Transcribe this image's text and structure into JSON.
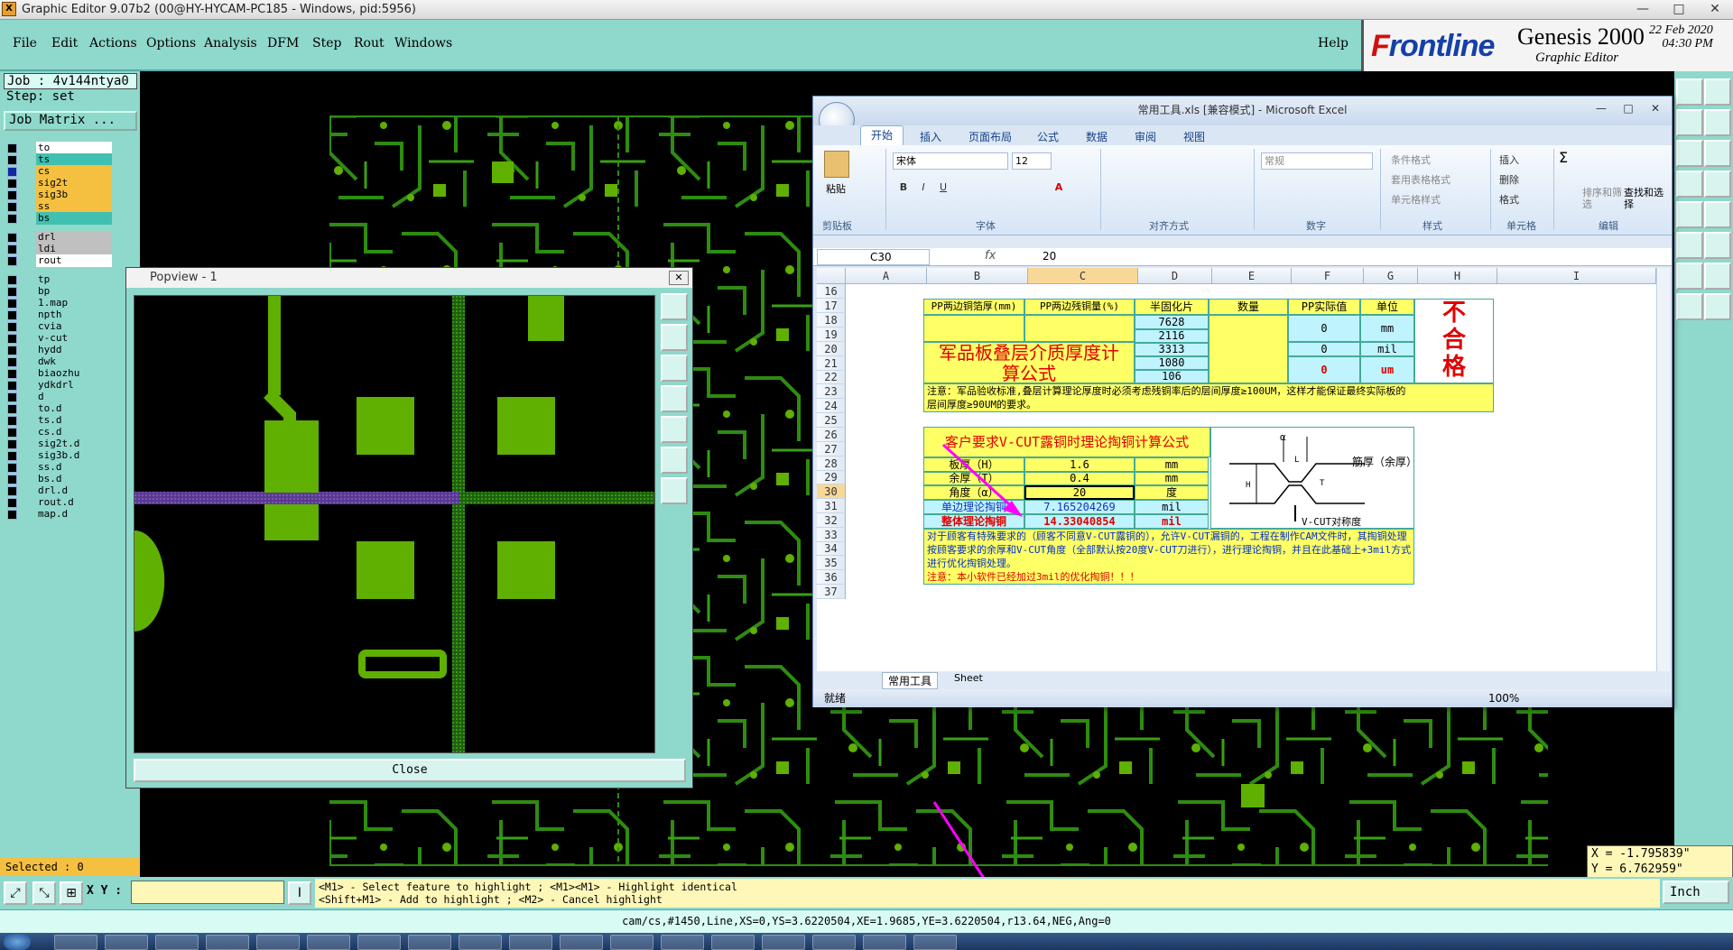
{
  "window": {
    "title": "Graphic Editor 9.07b2 (00@HY-HYCAM-PC185 - Windows, pid:5956)",
    "icon": "genesis-app-icon",
    "minimize": "—",
    "maximize": "□",
    "close": "✕"
  },
  "menu": {
    "items": [
      "File",
      "Edit",
      "Actions",
      "Options",
      "Analysis",
      "DFM",
      "Step",
      "Rout",
      "Windows"
    ],
    "help": "Help"
  },
  "logo": {
    "brand_f": "F",
    "brand": "rontline",
    "product": "Genesis 2000",
    "subtitle": "Graphic Editor",
    "date": "22 Feb 2020",
    "time": "04:30 PM"
  },
  "job": {
    "job_label": "Job : 4v144ntya0",
    "step_label": "Step: set",
    "matrix_button": "Job Matrix ..."
  },
  "layers": [
    {
      "name": "to",
      "color": "#ffffff",
      "checked": false
    },
    {
      "name": "ts",
      "color": "#40c0b0",
      "checked": false
    },
    {
      "name": "cs",
      "color": "#f5c040",
      "checked": true
    },
    {
      "name": "sig2t",
      "color": "#f5c040",
      "checked": false
    },
    {
      "name": "sig3b",
      "color": "#f5c040",
      "checked": false
    },
    {
      "name": "ss",
      "color": "#f5c040",
      "checked": false
    },
    {
      "name": "bs",
      "color": "#40c0b0",
      "checked": false
    },
    {
      "name": "drl",
      "color": "#c0c0c0",
      "checked": false
    },
    {
      "name": "ldi",
      "color": "#c0c0c0",
      "checked": false
    },
    {
      "name": "rout",
      "color": "#ffffff",
      "checked": false
    },
    {
      "name": "tp",
      "color": "#8fd8cc",
      "checked": false
    },
    {
      "name": "bp",
      "color": "#8fd8cc",
      "checked": false
    },
    {
      "name": "1.map",
      "color": "#8fd8cc",
      "checked": false
    },
    {
      "name": "npth",
      "color": "#8fd8cc",
      "checked": false
    },
    {
      "name": "cvia",
      "color": "#8fd8cc",
      "checked": false
    },
    {
      "name": "v-cut",
      "color": "#8fd8cc",
      "checked": false
    },
    {
      "name": "hydd",
      "color": "#8fd8cc",
      "checked": false
    },
    {
      "name": "dwk",
      "color": "#8fd8cc",
      "checked": false
    },
    {
      "name": "biaozhu",
      "color": "#8fd8cc",
      "checked": false
    },
    {
      "name": "ydkdrl",
      "color": "#8fd8cc",
      "checked": false
    },
    {
      "name": "d",
      "color": "#8fd8cc",
      "checked": false
    },
    {
      "name": "to.d",
      "color": "#8fd8cc",
      "checked": false
    },
    {
      "name": "ts.d",
      "color": "#8fd8cc",
      "checked": false
    },
    {
      "name": "cs.d",
      "color": "#8fd8cc",
      "checked": false
    },
    {
      "name": "sig2t.d",
      "color": "#8fd8cc",
      "checked": false
    },
    {
      "name": "sig3b.d",
      "color": "#8fd8cc",
      "checked": false
    },
    {
      "name": "ss.d",
      "color": "#8fd8cc",
      "checked": false
    },
    {
      "name": "bs.d",
      "color": "#8fd8cc",
      "checked": false
    },
    {
      "name": "drl.d",
      "color": "#8fd8cc",
      "checked": false
    },
    {
      "name": "rout.d",
      "color": "#8fd8cc",
      "checked": false
    },
    {
      "name": "map.d",
      "color": "#8fd8cc",
      "checked": false
    }
  ],
  "selected": "Selected : 0",
  "coords": {
    "x": "X = -1.795839\"",
    "y": "Y = 6.762959\""
  },
  "bottom": {
    "xy_label": "X Y :",
    "xy_value": "",
    "hint_line1": "<M1> - Select feature to highlight ; <M1><M1> - Highlight identical",
    "hint_line2": "<Shift+M1> - Add to highlight ; <M2> - Cancel highlight",
    "units": "Inch"
  },
  "status": "cam/cs,#1450,Line,XS=0,YS=3.6220504,XE=1.9685,YE=3.6220504,r13.64,NEG,Ang=0",
  "popview": {
    "title": "Popview - 1",
    "close": "Close"
  },
  "excel": {
    "title": "常用工具.xls  [兼容模式] - Microsoft Excel",
    "tabs": [
      "开始",
      "插入",
      "页面布局",
      "公式",
      "数据",
      "审阅",
      "视图"
    ],
    "groups": [
      "剪贴板",
      "字体",
      "对齐方式",
      "数字",
      "样式",
      "单元格",
      "编辑"
    ],
    "paste": "粘贴",
    "font": "宋体",
    "size": "12",
    "numfmt": "常规",
    "styles": [
      "条件格式",
      "套用表格格式",
      "单元格样式"
    ],
    "cells_btns": [
      "插入",
      "删除",
      "格式"
    ],
    "edit_btns": [
      "排序和筛选",
      "查找和选择"
    ],
    "namebox": "C30",
    "fx": "fx",
    "formula": "20",
    "columns": [
      "A",
      "B",
      "C",
      "D",
      "E",
      "F",
      "G",
      "H",
      "I"
    ],
    "rows": [
      "16",
      "17",
      "18",
      "19",
      "20",
      "21",
      "22",
      "23",
      "24",
      "25",
      "26",
      "27",
      "28",
      "29",
      "30",
      "31",
      "32",
      "33",
      "34",
      "35",
      "36",
      "37"
    ],
    "pp": {
      "h1": "PP两边铜箔厚(mm)",
      "h2": "PP两边残铜量(%)",
      "h3": "半固化片",
      "h4": "数量",
      "h5": "PP实际值",
      "h6": "单位",
      "types": [
        "7628",
        "2116",
        "3313",
        "1080",
        "106"
      ],
      "v1": "0",
      "u1": "mm",
      "v2": "0",
      "u2": "mil",
      "v3": "0",
      "u3": "um",
      "title1": "军品板叠层介质厚度计",
      "title2": "算公式",
      "fail1": "不",
      "fail2": "合",
      "fail3": "格",
      "note1": "注意：军品验收标准,叠层计算理论厚度时必须考虑残铜率后的层间厚度≥100UM，这样才能保证最终实际板的",
      "note2": "层间厚度≥90UM的要求。"
    },
    "vcut": {
      "title": "客户要求V-CUT露铜时理论掏铜计算公式",
      "r1": "板厚（H）",
      "v1": "1.6",
      "u1": "mm",
      "r2": "余厚（T）",
      "v2": "0.4",
      "u2": "mm",
      "r3": "角度（α）",
      "v3": "20",
      "u3": "度",
      "r4": "单边理论掏铜",
      "v4": "7.165204269",
      "u4": "mil",
      "r5": "整体理论掏铜",
      "v5": "14.33040854",
      "u5": "mil",
      "diag_alpha": "α",
      "diag_h": "H",
      "diag_l": "L",
      "diag_t": "T",
      "diag_label": "筋厚（余厚）",
      "diag_caption": "V-CUT对称度",
      "note1": "对于顾客有特殊要求的（顾客不同意V-CUT露铜的），允许V-CUT漏铜的，工程在制作CAM文件时，其掏铜处理",
      "note2": "按顾客要求的余厚和V-CUT角度（全部默认按20度V-CUT刀进行），进行理论掏铜，并且在此基础上+3mil方式",
      "note3": "进行优化掏铜处理。",
      "note4": "注意：本小软件已经加过3mil的优化掏铜！！！"
    },
    "sheets": [
      "常用工具",
      "Sheet"
    ],
    "status": "就绪",
    "zoom": "100%"
  },
  "colors": {
    "panel": "#8fd8cc",
    "copper": "#5fb000",
    "trace": "#2e8c10",
    "magenta": "#ff00ff"
  }
}
